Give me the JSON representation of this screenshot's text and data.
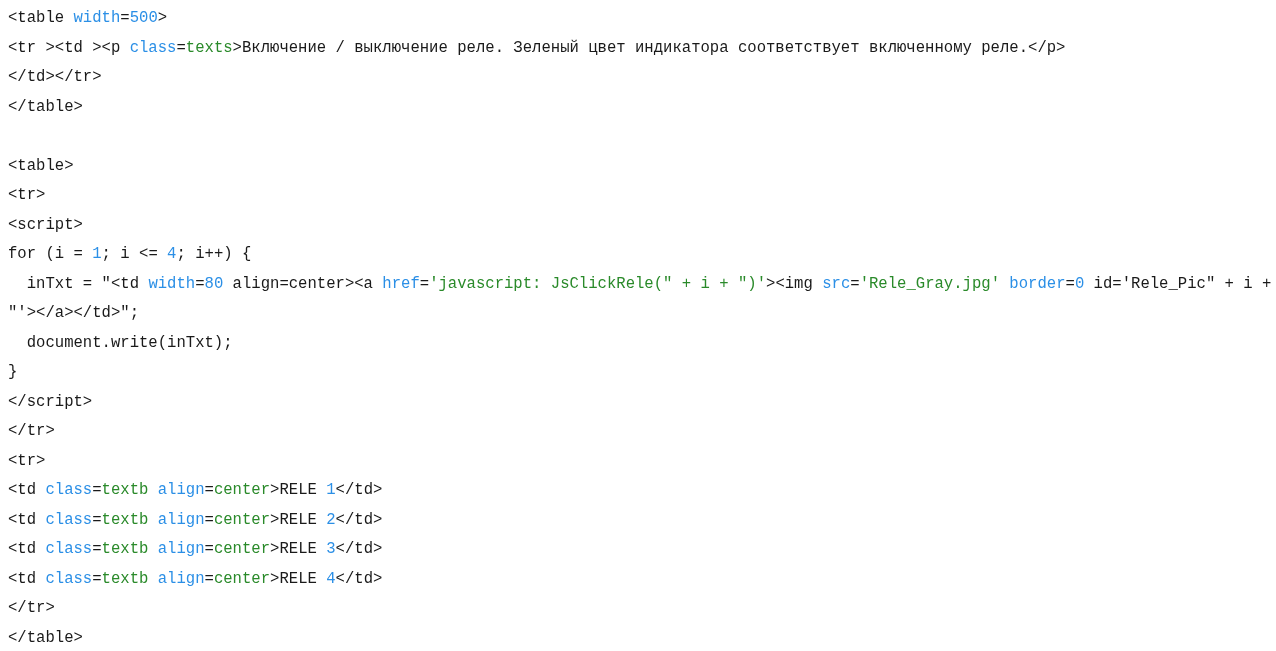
{
  "code_listing": {
    "blocks": [
      {
        "lines": [
          {
            "tokens": [
              {
                "kind": "plain",
                "text": "<table "
              },
              {
                "kind": "attr",
                "text": "width"
              },
              {
                "kind": "plain",
                "text": "="
              },
              {
                "kind": "number",
                "text": "500"
              },
              {
                "kind": "plain",
                "text": ">"
              }
            ]
          },
          {
            "tokens": [
              {
                "kind": "plain",
                "text": "<tr ><td ><p "
              },
              {
                "kind": "attr",
                "text": "class"
              },
              {
                "kind": "plain",
                "text": "="
              },
              {
                "kind": "value",
                "text": "texts"
              },
              {
                "kind": "plain",
                "text": ">Включение / выключение реле. Зеленый цвет индикатора соответствует включенному реле.</p>"
              }
            ]
          },
          {
            "tokens": [
              {
                "kind": "plain",
                "text": "</td></tr>"
              }
            ]
          },
          {
            "tokens": [
              {
                "kind": "plain",
                "text": "</table>"
              }
            ]
          }
        ]
      },
      {
        "lines": [
          {
            "tokens": [
              {
                "kind": "plain",
                "text": "<table>"
              }
            ]
          },
          {
            "tokens": [
              {
                "kind": "plain",
                "text": "<tr>"
              }
            ]
          },
          {
            "tokens": [
              {
                "kind": "plain",
                "text": "<script>"
              }
            ]
          },
          {
            "tokens": [
              {
                "kind": "plain",
                "text": "for (i = "
              },
              {
                "kind": "number",
                "text": "1"
              },
              {
                "kind": "plain",
                "text": "; i <= "
              },
              {
                "kind": "number",
                "text": "4"
              },
              {
                "kind": "plain",
                "text": "; i++) {"
              }
            ]
          },
          {
            "tokens": [
              {
                "kind": "plain",
                "text": "  inTxt = \"<td "
              },
              {
                "kind": "attr",
                "text": "width"
              },
              {
                "kind": "plain",
                "text": "="
              },
              {
                "kind": "number",
                "text": "80"
              },
              {
                "kind": "plain",
                "text": " align=center><a "
              },
              {
                "kind": "attr",
                "text": "href"
              },
              {
                "kind": "plain",
                "text": "="
              },
              {
                "kind": "value",
                "text": "'javascript: JsClickRele(\" + i + \")'"
              },
              {
                "kind": "plain",
                "text": "><img "
              },
              {
                "kind": "attr",
                "text": "src"
              },
              {
                "kind": "plain",
                "text": "="
              },
              {
                "kind": "value",
                "text": "'Rele_Gray.jpg'"
              },
              {
                "kind": "attr",
                "text": " border"
              },
              {
                "kind": "plain",
                "text": "="
              },
              {
                "kind": "number",
                "text": "0"
              },
              {
                "kind": "plain",
                "text": " id='Rele_Pic\" + i +"
              }
            ]
          },
          {
            "tokens": [
              {
                "kind": "plain",
                "text": "\"'></a></td>\";"
              }
            ]
          },
          {
            "tokens": [
              {
                "kind": "plain",
                "text": "  document.write(inTxt);"
              }
            ]
          },
          {
            "tokens": [
              {
                "kind": "plain",
                "text": "}"
              }
            ]
          },
          {
            "tokens": [
              {
                "kind": "plain",
                "text": "</script>"
              }
            ]
          },
          {
            "tokens": [
              {
                "kind": "plain",
                "text": "</tr>"
              }
            ]
          },
          {
            "tokens": [
              {
                "kind": "plain",
                "text": "<tr>"
              }
            ]
          },
          {
            "tokens": [
              {
                "kind": "plain",
                "text": "<td "
              },
              {
                "kind": "attr",
                "text": "class"
              },
              {
                "kind": "plain",
                "text": "="
              },
              {
                "kind": "value",
                "text": "textb"
              },
              {
                "kind": "attr",
                "text": " align"
              },
              {
                "kind": "plain",
                "text": "="
              },
              {
                "kind": "value",
                "text": "center"
              },
              {
                "kind": "plain",
                "text": ">RELE "
              },
              {
                "kind": "number",
                "text": "1"
              },
              {
                "kind": "plain",
                "text": "</td>"
              }
            ]
          },
          {
            "tokens": [
              {
                "kind": "plain",
                "text": "<td "
              },
              {
                "kind": "attr",
                "text": "class"
              },
              {
                "kind": "plain",
                "text": "="
              },
              {
                "kind": "value",
                "text": "textb"
              },
              {
                "kind": "attr",
                "text": " align"
              },
              {
                "kind": "plain",
                "text": "="
              },
              {
                "kind": "value",
                "text": "center"
              },
              {
                "kind": "plain",
                "text": ">RELE "
              },
              {
                "kind": "number",
                "text": "2"
              },
              {
                "kind": "plain",
                "text": "</td>"
              }
            ]
          },
          {
            "tokens": [
              {
                "kind": "plain",
                "text": "<td "
              },
              {
                "kind": "attr",
                "text": "class"
              },
              {
                "kind": "plain",
                "text": "="
              },
              {
                "kind": "value",
                "text": "textb"
              },
              {
                "kind": "attr",
                "text": " align"
              },
              {
                "kind": "plain",
                "text": "="
              },
              {
                "kind": "value",
                "text": "center"
              },
              {
                "kind": "plain",
                "text": ">RELE "
              },
              {
                "kind": "number",
                "text": "3"
              },
              {
                "kind": "plain",
                "text": "</td>"
              }
            ]
          },
          {
            "tokens": [
              {
                "kind": "plain",
                "text": "<td "
              },
              {
                "kind": "attr",
                "text": "class"
              },
              {
                "kind": "plain",
                "text": "="
              },
              {
                "kind": "value",
                "text": "textb"
              },
              {
                "kind": "attr",
                "text": " align"
              },
              {
                "kind": "plain",
                "text": "="
              },
              {
                "kind": "value",
                "text": "center"
              },
              {
                "kind": "plain",
                "text": ">RELE "
              },
              {
                "kind": "number",
                "text": "4"
              },
              {
                "kind": "plain",
                "text": "</td>"
              }
            ]
          },
          {
            "tokens": [
              {
                "kind": "plain",
                "text": "</tr>"
              }
            ]
          },
          {
            "tokens": [
              {
                "kind": "plain",
                "text": "</table>"
              }
            ]
          }
        ]
      }
    ]
  }
}
